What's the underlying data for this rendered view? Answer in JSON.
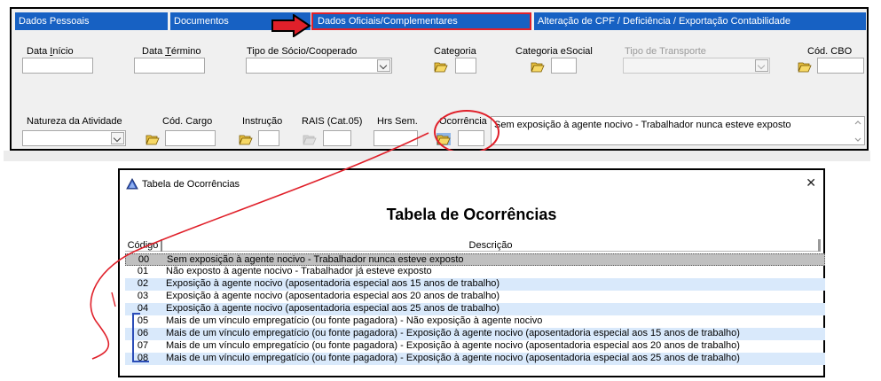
{
  "tabs": [
    {
      "label": "Dados Pessoais"
    },
    {
      "label": "Documentos"
    },
    {
      "label": "Dados Oficiais/Complementares"
    },
    {
      "label": "Alteração de CPF / Deficiência / Exportação Contabilidade"
    }
  ],
  "form": {
    "data_inicio": {
      "label_pre": "Data ",
      "label_u": "I",
      "label_post": "nício",
      "value": ""
    },
    "data_termino": {
      "label_pre": "Data ",
      "label_u": "T",
      "label_post": "érmino",
      "value": ""
    },
    "tipo_socio_label": "Tipo de Sócio/Cooperado",
    "categoria_label": "Categoria",
    "categoria_esocial_label": "Categoria eSocial",
    "tipo_transporte_label": "Tipo de Transporte",
    "cod_cbo_label": "Cód. CBO",
    "natureza_atividade_label": "Natureza da Atividade",
    "cod_cargo_label": "Cód. Cargo",
    "instrucao_label": "Instrução",
    "rais_label": "RAIS (Cat.05)",
    "hrs_sem_label": "Hrs Sem.",
    "ocorrencia_label": "Ocorrência",
    "ocorrencia_descricao": "Sem exposição à agente nocivo - Trabalhador nunca esteve exposto"
  },
  "dialog": {
    "window_title": "Tabela de Ocorrências",
    "heading": "Tabela de Ocorrências",
    "close_glyph": "✕",
    "columns": {
      "codigo": "Código",
      "descricao": "Descrição"
    },
    "rows": [
      {
        "code": "00",
        "desc": "Sem exposição à agente nocivo - Trabalhador nunca esteve exposto"
      },
      {
        "code": "01",
        "desc": "Não exposto à agente nocivo - Trabalhador já esteve exposto"
      },
      {
        "code": "02",
        "desc": "Exposição à agente nocivo (aposentadoria especial aos 15 anos de trabalho)"
      },
      {
        "code": "03",
        "desc": "Exposição à agente nocivo (aposentadoria especial aos 20 anos de trabalho)"
      },
      {
        "code": "04",
        "desc": "Exposição à agente nocivo (aposentadoria especial aos 25 anos de trabalho)"
      },
      {
        "code": "05",
        "desc": "Mais de um vínculo empregatício (ou fonte pagadora) - Não exposição à agente nocivo"
      },
      {
        "code": "06",
        "desc": "Mais de um vínculo empregatício (ou fonte pagadora) - Exposição à agente nocivo (aposentadoria especial aos 15 anos de trabalho)"
      },
      {
        "code": "07",
        "desc": "Mais de um vínculo empregatício (ou fonte pagadora) - Exposição à agente nocivo (aposentadoria especial aos 20 anos de trabalho)"
      },
      {
        "code": "08",
        "desc": "Mais de um vínculo empregatício (ou fonte pagadora) - Exposição à agente nocivo (aposentadoria especial aos 25 anos de trabalho)"
      }
    ],
    "selected_code": "00"
  },
  "colors": {
    "tab_blue": "#1761c3",
    "highlight_red": "#e0202a",
    "bracket_blue": "#2b4db8",
    "row_alt": "#d9e9fb",
    "row_selected": "#c0c0c0"
  },
  "icons": [
    "folder-open-icon",
    "dropdown-arrow-icon",
    "red-arrow-icon",
    "app-triangle-icon",
    "close-icon"
  ]
}
